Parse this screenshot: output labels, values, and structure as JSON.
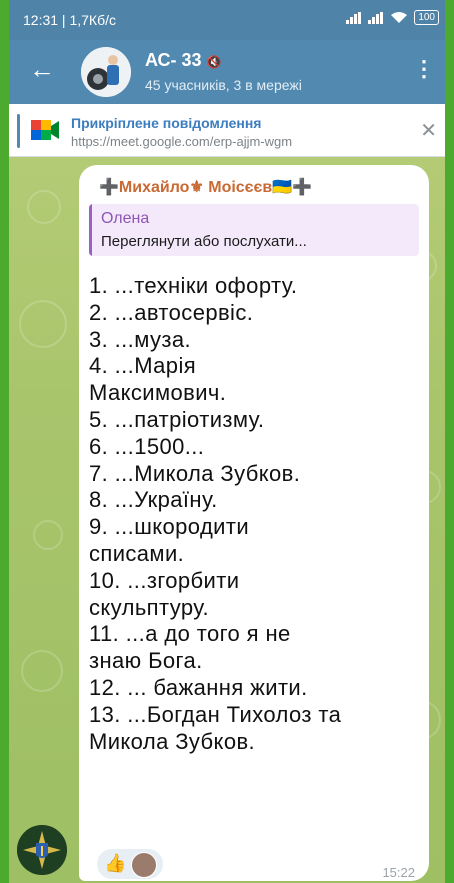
{
  "statusbar": {
    "time": "12:31 | 1,7Кб/с",
    "battery": "100"
  },
  "header": {
    "title": "АС- 33",
    "subtitle": "45 учасників, 3 в мережі"
  },
  "pinned": {
    "title": "Прикріплене повідомлення",
    "link": "https://meet.google.com/erp-ajjm-wgm"
  },
  "message": {
    "sender": "➕Михайло⚜ Моісєєв🇺🇦➕",
    "reply_name": "Олена",
    "reply_text": "Переглянути або послухати...",
    "lines": [
      "1. ...техніки офорту.",
      "2. ...автосервіс.",
      "3. ...муза.",
      "4. ...Марія",
      "Максимович.",
      "5. ...патріотизму.",
      "6. ...1500...",
      "7. ...Микола Зубков.",
      "8. ...Україну.",
      "9. ...шкородити",
      "списами.",
      "10. ...згорбити",
      "скульптуру.",
      "11. ...а до того я не",
      "знаю Бога.",
      "12. ... бажання жити.",
      "13. ...Богдан Тихолоз та",
      "Микола Зубков."
    ],
    "time": "15:22",
    "reaction": "👍"
  },
  "icons": [
    "back-arrow-icon",
    "mute-icon",
    "more-icon",
    "google-meet-icon",
    "close-icon",
    "wifi-icon",
    "signal-icon",
    "battery-icon"
  ]
}
